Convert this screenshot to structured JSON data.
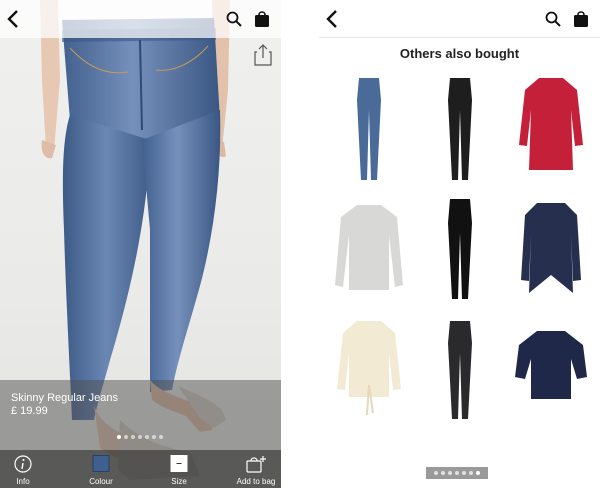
{
  "left": {
    "product": {
      "name": "Skinny Regular Jeans",
      "price": "£ 19.99"
    },
    "carousel": {
      "count": 7,
      "active": 0
    },
    "tabbar": {
      "info_label": "Info",
      "colour_label": "Colour",
      "size_label": "Size",
      "add_label": "Add to bag",
      "selected_colour": "#3f5f8f"
    }
  },
  "right": {
    "title": "Others also bought",
    "items": [
      "denim skinny jeans",
      "black skinny jeans",
      "red blouse",
      "grey knit sweater",
      "black coated trousers",
      "navy cardigan",
      "cream tie-waist blouse",
      "black skinny jeans",
      "navy knit top"
    ],
    "carousel": {
      "count": 7,
      "active": 6
    }
  },
  "colors": {
    "accent_blue": "#3f5f8f",
    "denim": "#4a6a98"
  }
}
